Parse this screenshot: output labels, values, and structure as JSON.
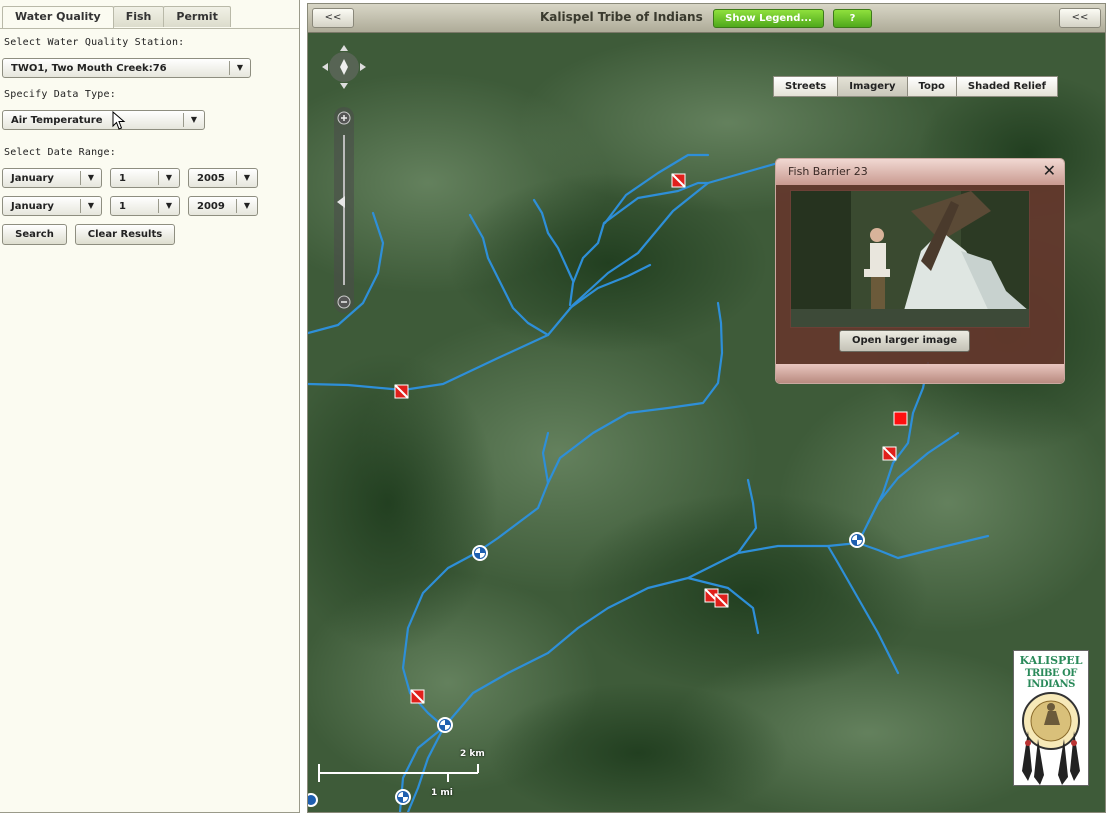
{
  "left_panel": {
    "tabs": [
      {
        "label": "Water Quality",
        "active": true
      },
      {
        "label": "Fish",
        "active": false
      },
      {
        "label": "Permit",
        "active": false
      }
    ],
    "station_label": "Select Water Quality Station:",
    "station_value": "TWO1, Two Mouth Creek:76",
    "data_type_label": "Specify Data Type:",
    "data_type_value": "Air Temperature",
    "date_range_label": "Select Date Range:",
    "start_month": "January",
    "start_day": "1",
    "start_year": "2005",
    "end_month": "January",
    "end_day": "1",
    "end_year": "2009",
    "search_label": "Search",
    "clear_label": "Clear Results"
  },
  "map_panel": {
    "title": "Kalispel Tribe of Indians",
    "legend_button": "Show Legend...",
    "help_button": "?",
    "collapse_left": "<<",
    "collapse_right": "<<",
    "basemaps": [
      {
        "label": "Streets",
        "active": false
      },
      {
        "label": "Imagery",
        "active": true
      },
      {
        "label": "Topo",
        "active": false
      },
      {
        "label": "Shaded Relief",
        "active": false
      }
    ],
    "popup": {
      "title": "Fish Barrier 23",
      "close": "✕",
      "button": "Open larger image"
    },
    "scale": {
      "km": "2 km",
      "mi": "1 mi"
    },
    "logo": {
      "line1": "KALISPEL",
      "line2": "TRIBE OF INDIANS"
    },
    "colors": {
      "stream": "#2e8fd8",
      "barrier": "#e0201b",
      "station": "#1e5fb0",
      "legend_green": "#5bb521"
    }
  }
}
